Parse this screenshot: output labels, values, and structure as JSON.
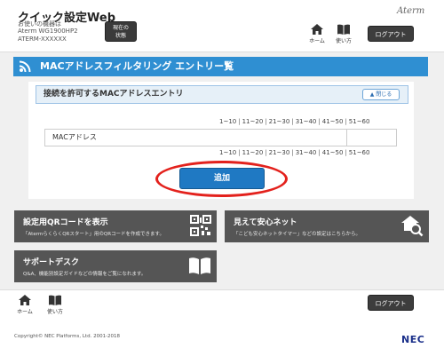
{
  "header": {
    "app_title": "クイック設定Web",
    "device_label": "お使いの機器は",
    "device_model": "Aterm WG1900HP2",
    "device_serial": "ATERM-XXXXXX",
    "status_button": "現在の\n状態",
    "brand": "Aterm",
    "home_label": "ホーム",
    "usage_label": "使い方",
    "logout_label": "ログアウト"
  },
  "main": {
    "section_title": "MACアドレスフィルタリング エントリー覧",
    "panel_title": "接続を許可するMACアドレスエントリ",
    "close_label": "閉じる",
    "pager": [
      "1~10",
      "11~20",
      "21~30",
      "31~40",
      "41~50",
      "51~60"
    ],
    "table": {
      "column_mac": "MACアドレス"
    },
    "add_label": "追加"
  },
  "tiles": [
    {
      "title": "設定用QRコードを表示",
      "desc": "「AtermらくらくQRスタート」用のQRコードを作成できます。",
      "icon": "qr-code-icon"
    },
    {
      "title": "見えて安心ネット",
      "desc": "「こども安心ネットタイマー」などの設定はこちらから。",
      "icon": "house-search-icon"
    },
    {
      "title": "サポートデスク",
      "desc": "Q&A、機能別設定ガイドなどの情報をご覧になれます。",
      "icon": "book-icon"
    }
  ],
  "footer": {
    "home_label": "ホーム",
    "usage_label": "使い方",
    "logout_label": "ログアウト",
    "copyright": "Copyright© NEC Platforms, Ltd. 2001-2018",
    "logo": "NEC"
  },
  "colors": {
    "accent_blue": "#2f8fd2",
    "button_blue": "#1f79c3",
    "highlight_red": "#e3211c",
    "tile_gray": "#555555",
    "dark_button": "#3d3d3d"
  }
}
